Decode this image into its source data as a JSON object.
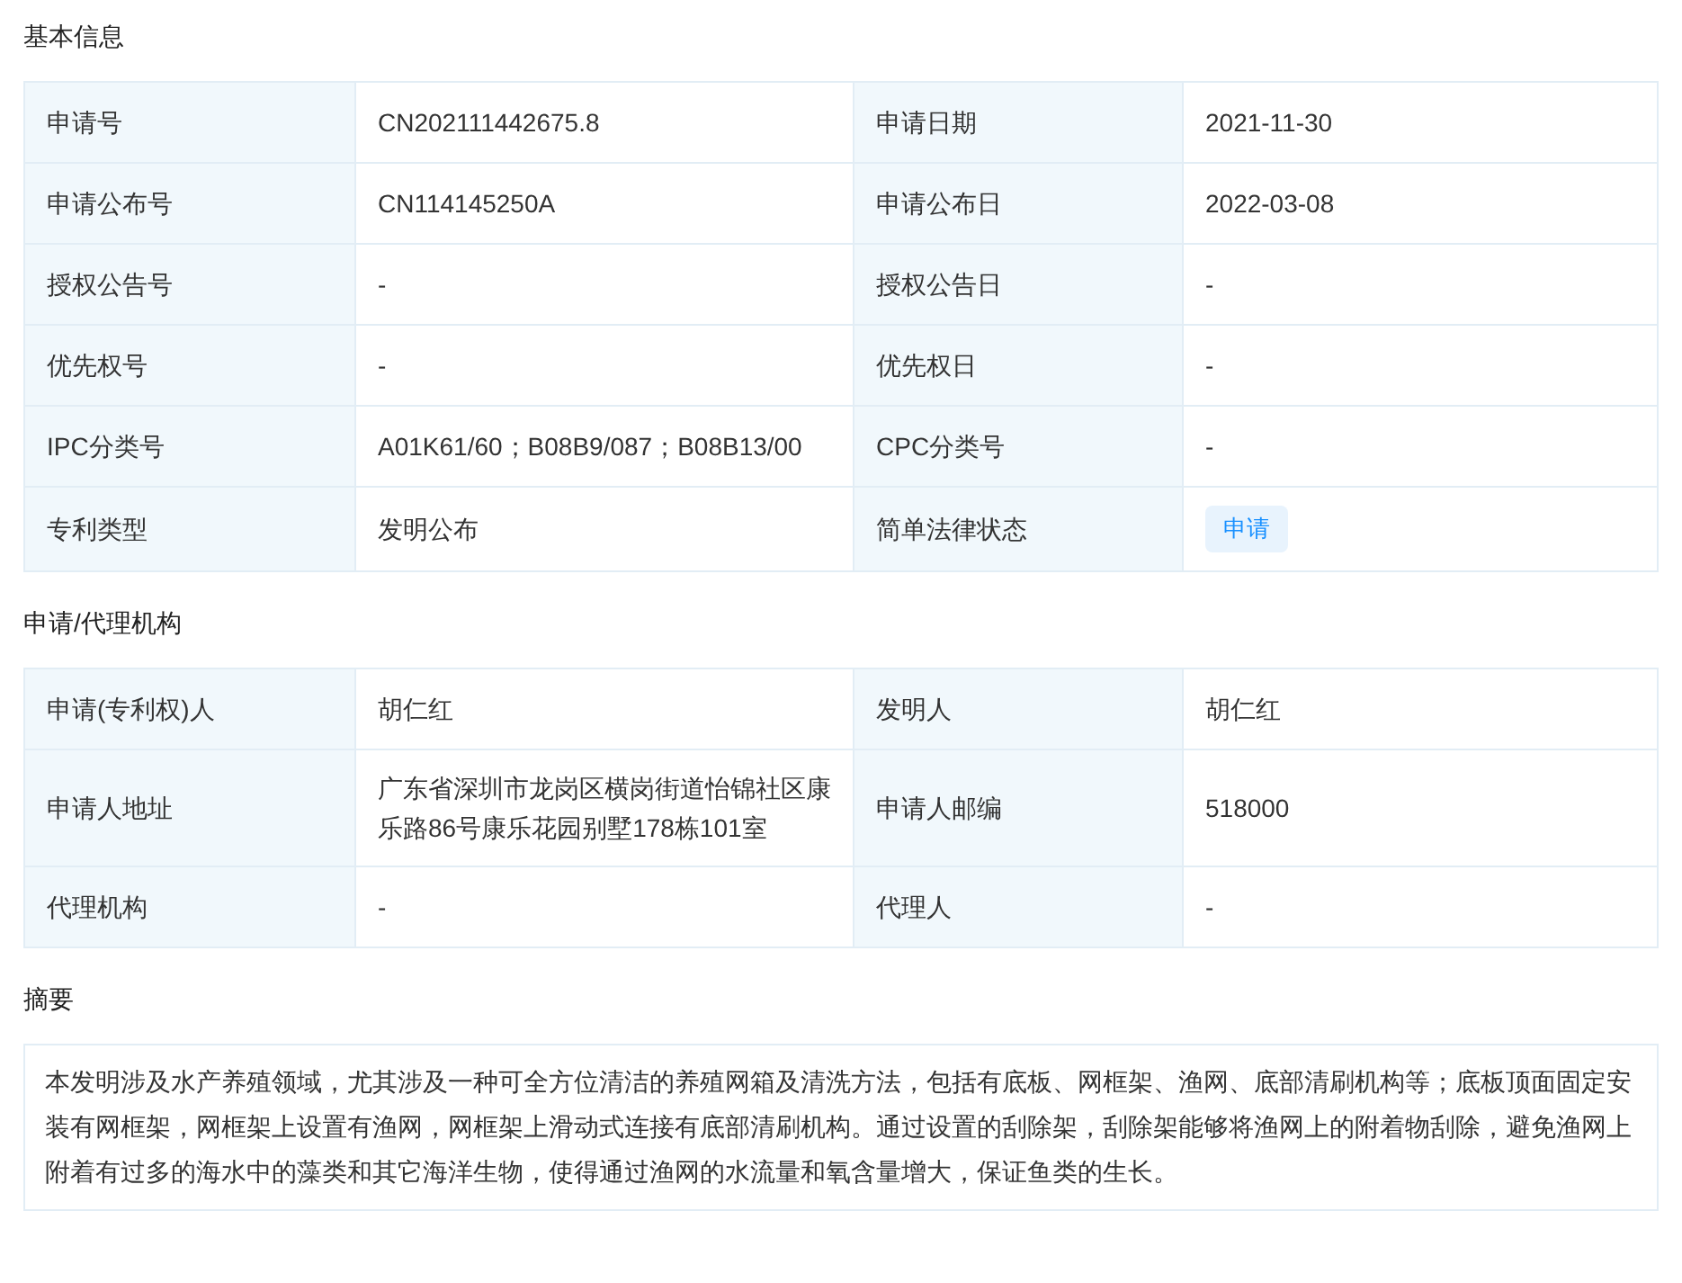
{
  "sections": [
    {
      "title": "基本信息",
      "rows": [
        [
          {
            "label": "申请号",
            "value": "CN202111442675.8",
            "kind": "text"
          },
          {
            "label": "申请日期",
            "value": "2021-11-30",
            "kind": "text"
          }
        ],
        [
          {
            "label": "申请公布号",
            "value": "CN114145250A",
            "kind": "text"
          },
          {
            "label": "申请公布日",
            "value": "2022-03-08",
            "kind": "text"
          }
        ],
        [
          {
            "label": "授权公告号",
            "value": "-",
            "kind": "text"
          },
          {
            "label": "授权公告日",
            "value": "-",
            "kind": "text"
          }
        ],
        [
          {
            "label": "优先权号",
            "value": "-",
            "kind": "text"
          },
          {
            "label": "优先权日",
            "value": "-",
            "kind": "text"
          }
        ],
        [
          {
            "label": "IPC分类号",
            "value": "A01K61/60；B08B9/087；B08B13/00",
            "kind": "text"
          },
          {
            "label": "CPC分类号",
            "value": "-",
            "kind": "text"
          }
        ],
        [
          {
            "label": "专利类型",
            "value": "发明公布",
            "kind": "text"
          },
          {
            "label": "简单法律状态",
            "value": "申请",
            "kind": "tag"
          }
        ]
      ]
    },
    {
      "title": "申请/代理机构",
      "rows": [
        [
          {
            "label": "申请(专利权)人",
            "value": "胡仁红",
            "kind": "text"
          },
          {
            "label": "发明人",
            "value": "胡仁红",
            "kind": "text"
          }
        ],
        [
          {
            "label": "申请人地址",
            "value": "广东省深圳市龙岗区横岗街道怡锦社区康乐路86号康乐花园别墅178栋101室",
            "kind": "text"
          },
          {
            "label": "申请人邮编",
            "value": "518000",
            "kind": "text"
          }
        ],
        [
          {
            "label": "代理机构",
            "value": "-",
            "kind": "text"
          },
          {
            "label": "代理人",
            "value": "-",
            "kind": "text"
          }
        ]
      ]
    }
  ],
  "abstract": {
    "title": "摘要",
    "text": "本发明涉及水产养殖领域，尤其涉及一种可全方位清洁的养殖网箱及清洗方法，包括有底板、网框架、渔网、底部清刷机构等；底板顶面固定安装有网框架，网框架上设置有渔网，网框架上滑动式连接有底部清刷机构。通过设置的刮除架，刮除架能够将渔网上的附着物刮除，避免渔网上附着有过多的海水中的藻类和其它海洋生物，使得通过渔网的水流量和氧含量增大，保证鱼类的生长。"
  }
}
